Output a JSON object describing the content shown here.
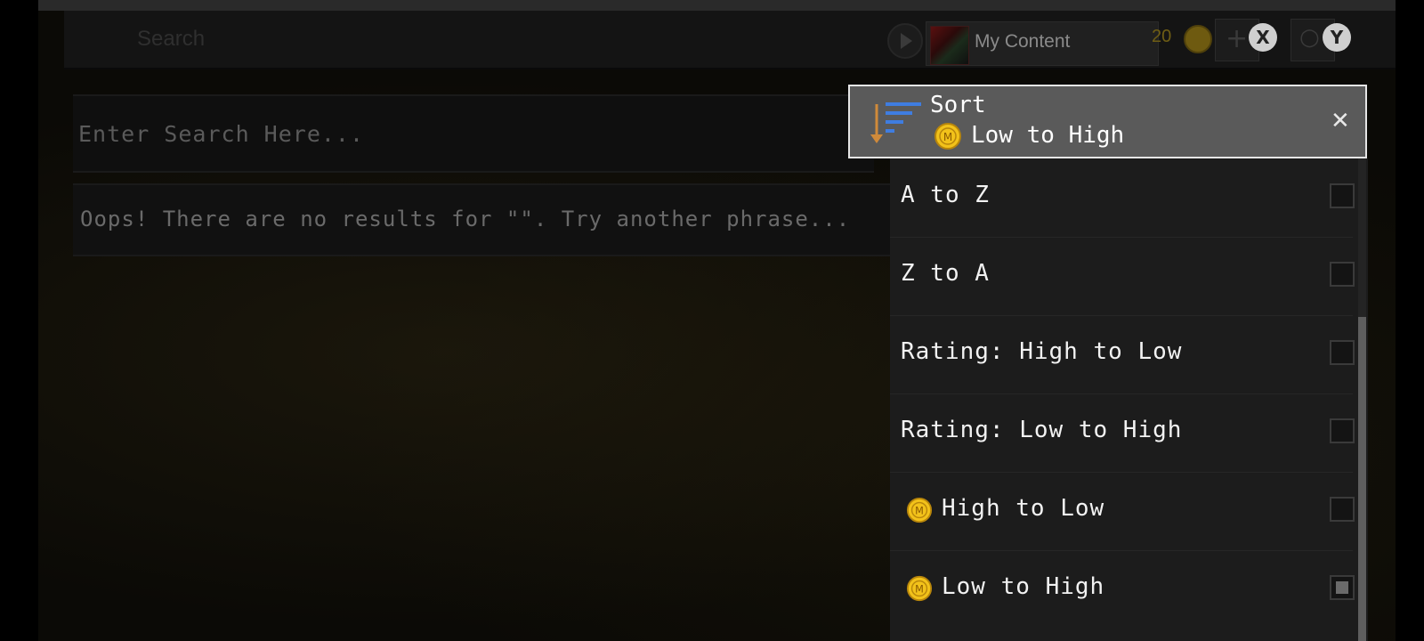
{
  "header": {
    "search_label": "Search",
    "my_content_label": "My Content",
    "coin_count": "20",
    "button_x": "X",
    "button_y": "Y"
  },
  "search": {
    "placeholder": "Enter Search Here...",
    "no_results": "Oops! There are no results for \"\". Try another phrase..."
  },
  "sort": {
    "title": "Sort",
    "current": "Low to High",
    "options": [
      {
        "label": "A to Z",
        "coin": false,
        "checked": false
      },
      {
        "label": "Z to A",
        "coin": false,
        "checked": false
      },
      {
        "label": "Rating: High to Low",
        "coin": false,
        "checked": false
      },
      {
        "label": "Rating: Low to High",
        "coin": false,
        "checked": false
      },
      {
        "label": "High to Low",
        "coin": true,
        "checked": false
      },
      {
        "label": "Low to High",
        "coin": true,
        "checked": true
      }
    ]
  },
  "colors": {
    "coin": "#f2c21a",
    "header_bg": "#5a5a5a",
    "panel_bg": "#1c1c1c"
  }
}
